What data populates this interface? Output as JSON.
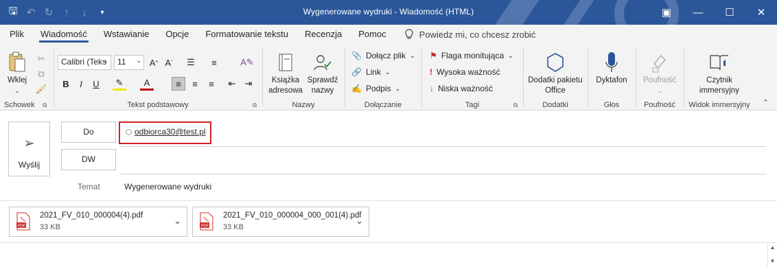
{
  "window": {
    "title": "Wygenerowane wydruki  -  Wiadomość (HTML)"
  },
  "ribbon_tabs": [
    "Plik",
    "Wiadomość",
    "Wstawianie",
    "Opcje",
    "Formatowanie tekstu",
    "Recenzja",
    "Pomoc"
  ],
  "tell_me": "Powiedz mi, co chcesz zrobić",
  "groups": {
    "clipboard": {
      "paste": "Wklej",
      "label": "Schowek"
    },
    "basic_text": {
      "font_name": "Calibri (Teks",
      "font_size": "11",
      "label": "Tekst podstawowy"
    },
    "names": {
      "address_book": "Książka adresowa",
      "check_names": "Sprawdź nazwy",
      "label": "Nazwy"
    },
    "include": {
      "attach_file": "Dołącz plik",
      "link": "Link",
      "signature": "Podpis",
      "label": "Dołączanie"
    },
    "tags": {
      "follow_up": "Flaga monitująca",
      "high": "Wysoka ważność",
      "low": "Niska ważność",
      "label": "Tagi"
    },
    "addins": {
      "office_addins": "Dodatki pakietu Office",
      "label": "Dodatki"
    },
    "voice": {
      "dictate": "Dyktafon",
      "label": "Głos"
    },
    "sensitivity": {
      "sensitivity": "Poufność",
      "label": "Poufność"
    },
    "immersive": {
      "reader": "Czytnik immersyjny",
      "label": "Widok immersyjny"
    }
  },
  "compose": {
    "send": "Wyślij",
    "to_label": "Do",
    "cc_label": "DW",
    "subject_label": "Temat",
    "to_value": "odbiorca30@test.pl",
    "subject_value": "Wygenerowane wydruki"
  },
  "attachments": [
    {
      "name": "2021_FV_010_000004(4).pdf",
      "size": "33 KB"
    },
    {
      "name": "2021_FV_010_000004_000_001(4).pdf",
      "size": "33 KB"
    }
  ],
  "colors": {
    "titlebar": "#2b579a",
    "ribbon_bg": "#f3f3f3",
    "highlight_border": "#d21f26",
    "flag": "#c4262e",
    "icon_blue": "#2b579a",
    "pdf_red": "#d0312d"
  }
}
